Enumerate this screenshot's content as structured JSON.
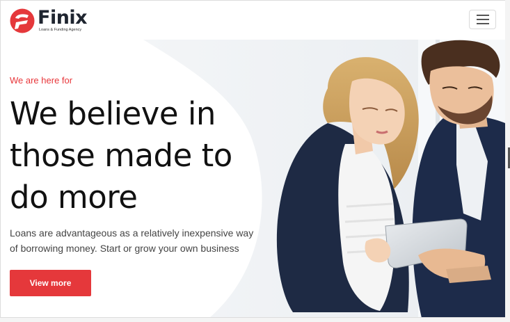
{
  "brand": {
    "name": "Finix",
    "tagline": "Loans & Funding Agency",
    "accent_color": "#e5383b"
  },
  "navbar": {
    "menu_icon": "hamburger-icon"
  },
  "hero": {
    "eyebrow": "We are here for",
    "headline": "We believe in those made to do more",
    "lead": "Loans are advantageous as a relatively inexpensive way of borrowing money. Start or grow your own business",
    "cta_label": "View more",
    "image": "business-couple-with-tablet-photo"
  }
}
